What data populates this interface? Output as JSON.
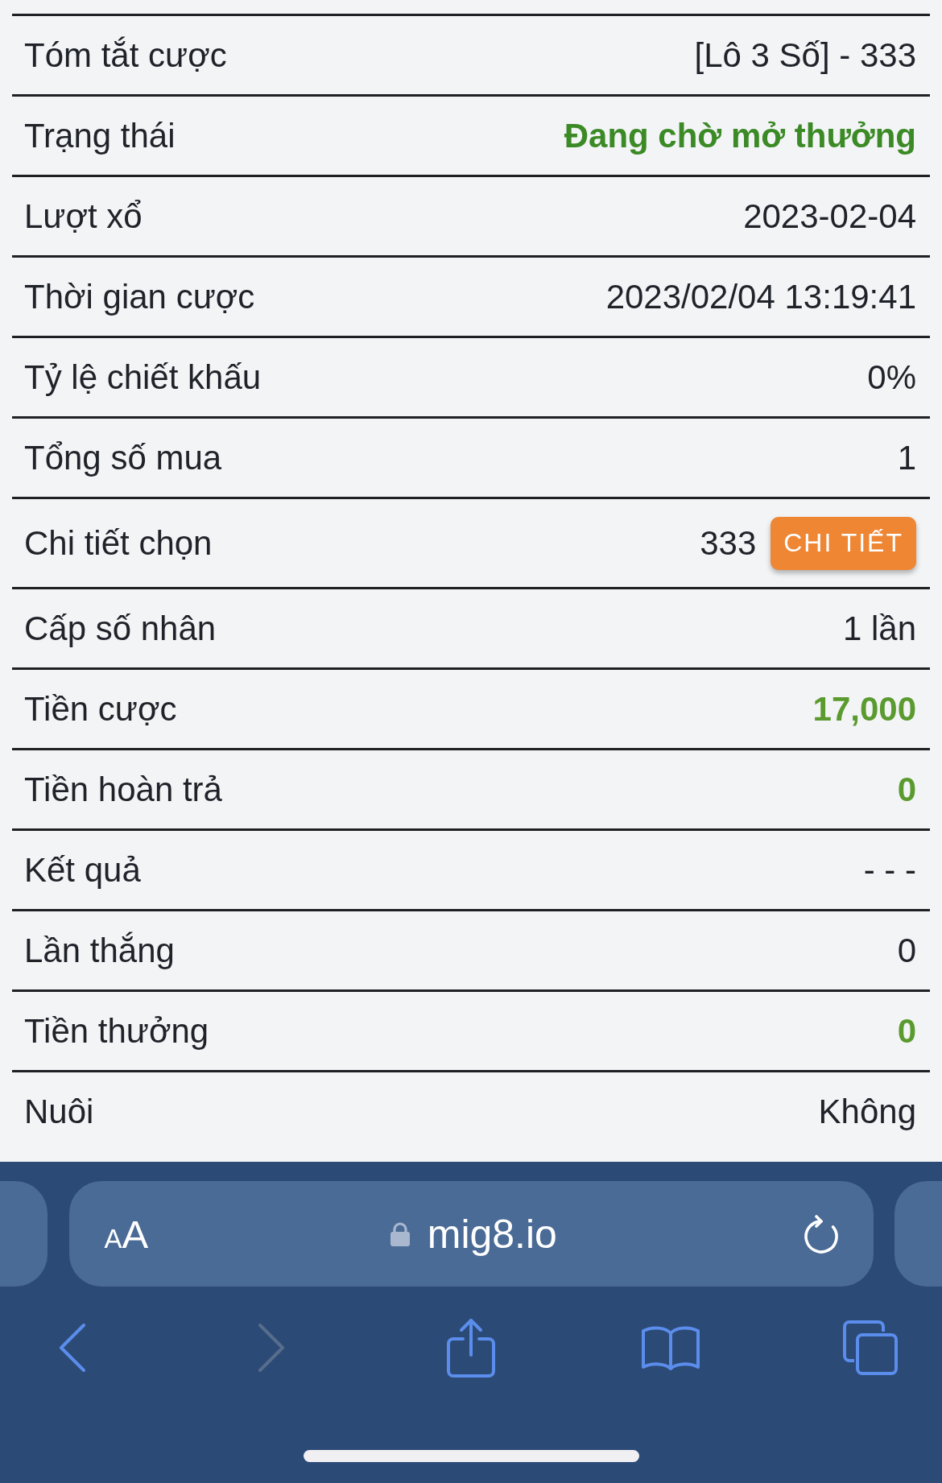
{
  "rows": [
    {
      "kind": "text",
      "label": "Tóm tắt cược",
      "value": "[Lô 3 Số] - 333"
    },
    {
      "kind": "status",
      "label": "Trạng thái",
      "value": "Đang chờ mở thưởng"
    },
    {
      "kind": "text",
      "label": "Lượt xổ",
      "value": "2023-02-04"
    },
    {
      "kind": "text",
      "label": "Thời gian cược",
      "value": "2023/02/04 13:19:41"
    },
    {
      "kind": "text",
      "label": "Tỷ lệ chiết khấu",
      "value": "0%"
    },
    {
      "kind": "text",
      "label": "Tổng số mua",
      "value": "1"
    },
    {
      "kind": "detail",
      "label": "Chi tiết chọn",
      "value": "333",
      "button": "CHI TIẾT"
    },
    {
      "kind": "text",
      "label": "Cấp số nhân",
      "value": "1 lần"
    },
    {
      "kind": "amount",
      "label": "Tiền cược",
      "value": "17,000"
    },
    {
      "kind": "amount",
      "label": "Tiền hoàn trả",
      "value": "0"
    },
    {
      "kind": "text",
      "label": "Kết quả",
      "value": "- - -"
    },
    {
      "kind": "text",
      "label": "Lần thắng",
      "value": "0"
    },
    {
      "kind": "amount",
      "label": "Tiền thưởng",
      "value": "0"
    },
    {
      "kind": "text",
      "label": "Nuôi",
      "value": "Không"
    }
  ],
  "browser": {
    "text_size_button": {
      "small": "A",
      "large": "A"
    },
    "secure": true,
    "url": "mig8.io",
    "toolbar": [
      {
        "kind": "back",
        "disabled": false
      },
      {
        "kind": "forward",
        "disabled": true
      },
      {
        "kind": "share",
        "disabled": false
      },
      {
        "kind": "bookmarks",
        "disabled": false
      },
      {
        "kind": "tabs",
        "disabled": false
      }
    ]
  }
}
